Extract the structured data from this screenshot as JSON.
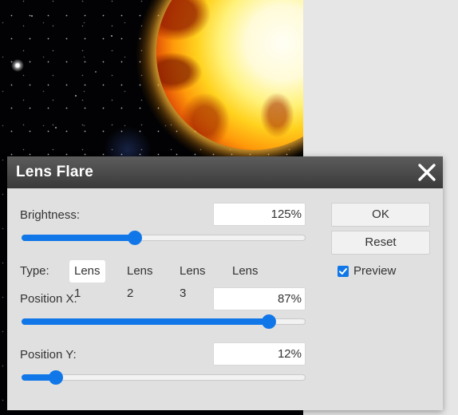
{
  "dialog": {
    "title": "Lens Flare",
    "close_icon": "close-icon"
  },
  "brightness": {
    "label": "Brightness:",
    "value_text": "125%",
    "slider_fraction": 0.4
  },
  "type": {
    "label": "Type:",
    "options": [
      "Lens 1",
      "Lens 2",
      "Lens 3",
      "Lens 4"
    ],
    "selected": "Lens 1"
  },
  "position_x": {
    "label": "Position X:",
    "value_text": "87%",
    "slider_fraction": 0.87
  },
  "position_y": {
    "label": "Position Y:",
    "value_text": "12%",
    "slider_fraction": 0.12
  },
  "buttons": {
    "ok": "OK",
    "reset": "Reset"
  },
  "preview": {
    "label": "Preview",
    "checked": true
  },
  "colors": {
    "accent": "#1177e8",
    "titlebar": "#4a4a4a",
    "dialog_bg": "#e0e0e0"
  }
}
